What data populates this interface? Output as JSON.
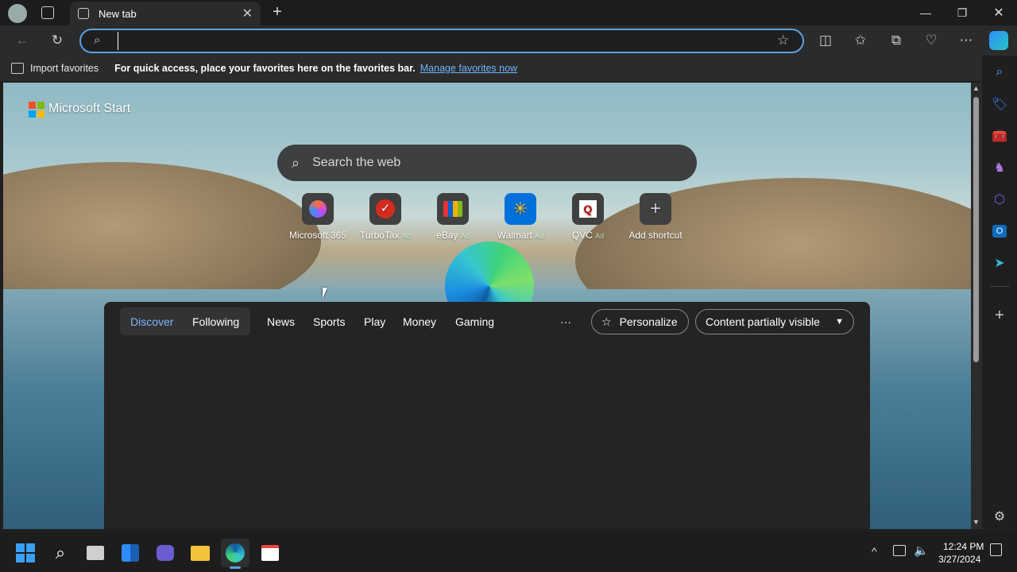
{
  "tab": {
    "title": "New tab"
  },
  "address": {
    "value": "",
    "placeholder": ""
  },
  "favbar": {
    "import_label": "Import favorites",
    "message": "For quick access, place your favorites here on the favorites bar.",
    "manage_link": "Manage favorites now"
  },
  "start": {
    "brand": "Microsoft Start",
    "search_placeholder": "Search the web",
    "shortcuts": [
      {
        "label": "Microsoft 365",
        "ad": ""
      },
      {
        "label": "TurboTax",
        "ad": "Ad"
      },
      {
        "label": "eBay",
        "ad": "Ad"
      },
      {
        "label": "Walmart",
        "ad": "Ad"
      },
      {
        "label": "QVC",
        "ad": "Ad"
      },
      {
        "label": "Add shortcut",
        "ad": ""
      }
    ]
  },
  "feed": {
    "tabs": [
      "Discover",
      "Following"
    ],
    "categories": [
      "News",
      "Sports",
      "Play",
      "Money",
      "Gaming"
    ],
    "more": "···",
    "personalize": "Personalize",
    "visibility": "Content partially visible"
  },
  "clock": {
    "time": "12:24 PM",
    "date": "3/27/2024"
  },
  "colors": {
    "accent": "#5aa0e6",
    "link": "#6cb4ff",
    "discover": "#7fb6ff"
  }
}
